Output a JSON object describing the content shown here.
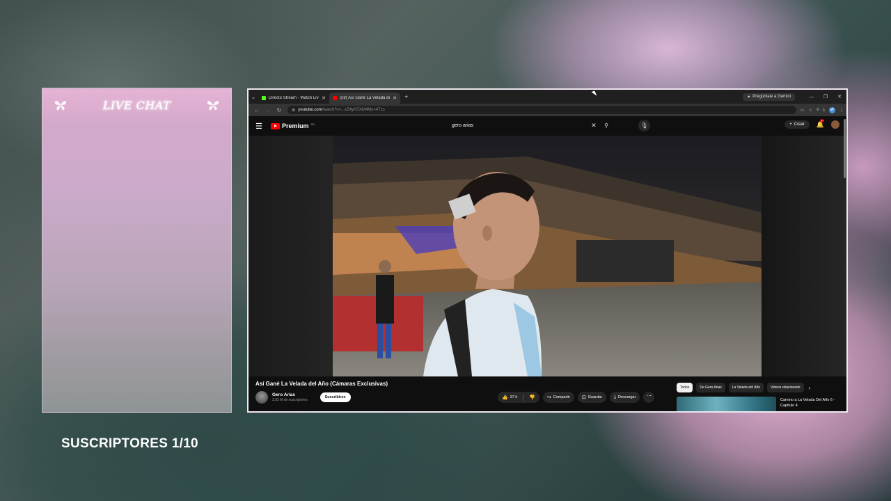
{
  "overlay": {
    "chat_title": "LIVE CHAT",
    "subs_text": "SUSCRIPTORES 1/10"
  },
  "browser": {
    "tabs": [
      {
        "label": "Directo Stream - Watch Live o",
        "active": false,
        "favicon_color": "#53fc18"
      },
      {
        "label": "(59) Así Gané La Velada de",
        "active": true,
        "favicon_color": "#ff0000"
      }
    ],
    "gemini_label": "Pregúntale a Gemini",
    "url_main": "youtube.com",
    "url_rest": "/watch?v=...xZ4yKSXM4Mc=471s",
    "icons": {
      "back": "back-arrow-icon",
      "forward": "forward-arrow-icon",
      "reload": "reload-icon",
      "bookmark": "star-icon"
    }
  },
  "youtube": {
    "logo_text": "Premium",
    "region": "AR",
    "search_value": "gero arias",
    "create_label": "Crear",
    "notification_count": "9+",
    "video_title": "Así Gané La Velada del Año (Cámaras Exclusivas)",
    "channel_name": "Gero Arias",
    "channel_subs": "3.93 M de suscriptores",
    "subscribe_label": "Suscribirse",
    "like_count": "37 k",
    "share_label": "Compartir",
    "save_label": "Guardar",
    "download_label": "Descargar",
    "chips": [
      "Todos",
      "De Gero Arias",
      "La Velada del Año",
      "Videos relacionado"
    ],
    "rec_title": "Camino a La Velada Del Año 6 - Capitulo 4"
  },
  "colors": {
    "accent_red": "#ff0000",
    "chat_pink": "#d7a9c8",
    "yt_bg": "#0f0f0f"
  }
}
